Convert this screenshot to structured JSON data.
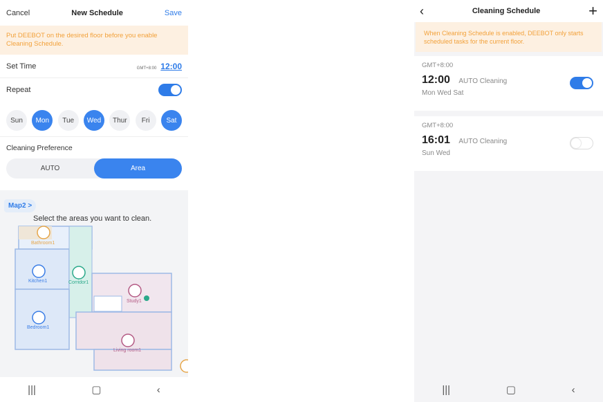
{
  "left": {
    "cancel_label": "Cancel",
    "title": "New Schedule",
    "save_label": "Save",
    "warning": "Put DEEBOT on the desired floor before you enable Cleaning Schedule.",
    "set_time_label": "Set Time",
    "timezone": "GMT+8:00",
    "time": "12:00",
    "repeat_label": "Repeat",
    "repeat_enabled": true,
    "days": [
      {
        "label": "Sun",
        "selected": false
      },
      {
        "label": "Mon",
        "selected": true
      },
      {
        "label": "Tue",
        "selected": false
      },
      {
        "label": "Wed",
        "selected": true
      },
      {
        "label": "Thur",
        "selected": false
      },
      {
        "label": "Fri",
        "selected": false
      },
      {
        "label": "Sat",
        "selected": true
      }
    ],
    "pref_label": "Cleaning Preference",
    "pref_options": [
      "AUTO",
      "Area"
    ],
    "pref_selected": "Area",
    "map_label": "Map2",
    "map_hint": "Select the areas you want to clean.",
    "rooms": {
      "bathroom": "Bathroom1",
      "kitchen": "Kitchen1",
      "corridor": "Corridor1",
      "study": "Study1",
      "bedroom": "Bedroom1",
      "living": "Living room1"
    }
  },
  "right": {
    "title": "Cleaning Schedule",
    "warning": "When Cleaning Schedule is enabled, DEEBOT only starts scheduled tasks for the current floor.",
    "schedules": [
      {
        "timezone": "GMT+8:00",
        "time": "12:00",
        "mode": "AUTO Cleaning",
        "days": "Mon Wed Sat",
        "enabled": true
      },
      {
        "timezone": "GMT+8:00",
        "time": "16:01",
        "mode": "AUTO Cleaning",
        "days": "Sun Wed",
        "enabled": false
      }
    ]
  },
  "colors": {
    "accent": "#2f7ce8",
    "warning_bg": "#fdf0e1",
    "warning_text": "#f2a13a"
  }
}
